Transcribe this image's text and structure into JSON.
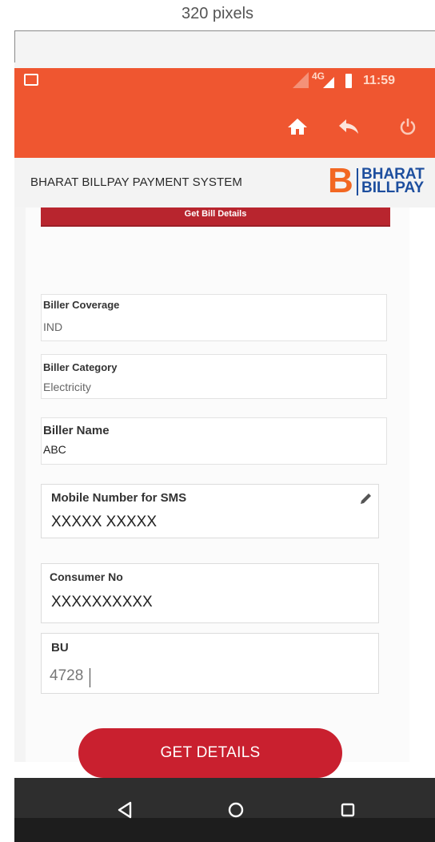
{
  "annotation": {
    "width_label": "320 pixels"
  },
  "status_bar": {
    "network": "4G",
    "time": "11:59"
  },
  "app_bar": {
    "icons": [
      "home-icon",
      "reply-back-icon",
      "power-icon"
    ]
  },
  "header": {
    "title": "BHARAT BILLPAY PAYMENT SYSTEM",
    "logo_letter": "B",
    "logo_line1": "BHARAT",
    "logo_line2": "BILLPAY"
  },
  "form": {
    "section_title": "Get Bill Details",
    "fields": [
      {
        "label": "Biller Coverage",
        "value": "IND"
      },
      {
        "label": "Biller Category",
        "value": "Electricity"
      },
      {
        "label": "Biller Name",
        "value": "ABC"
      },
      {
        "label": "Mobile Number for SMS",
        "value": "XXXXX XXXXX"
      },
      {
        "label": "Consumer No",
        "value": "XXXXXXXXXX"
      },
      {
        "label": "BU",
        "value": "4728"
      }
    ],
    "submit_label": "GET DETAILS"
  },
  "colors": {
    "app_bar": "#ef5630",
    "button": "#c9202f",
    "logo_orange": "#f26722",
    "logo_blue": "#1d4e9e"
  }
}
